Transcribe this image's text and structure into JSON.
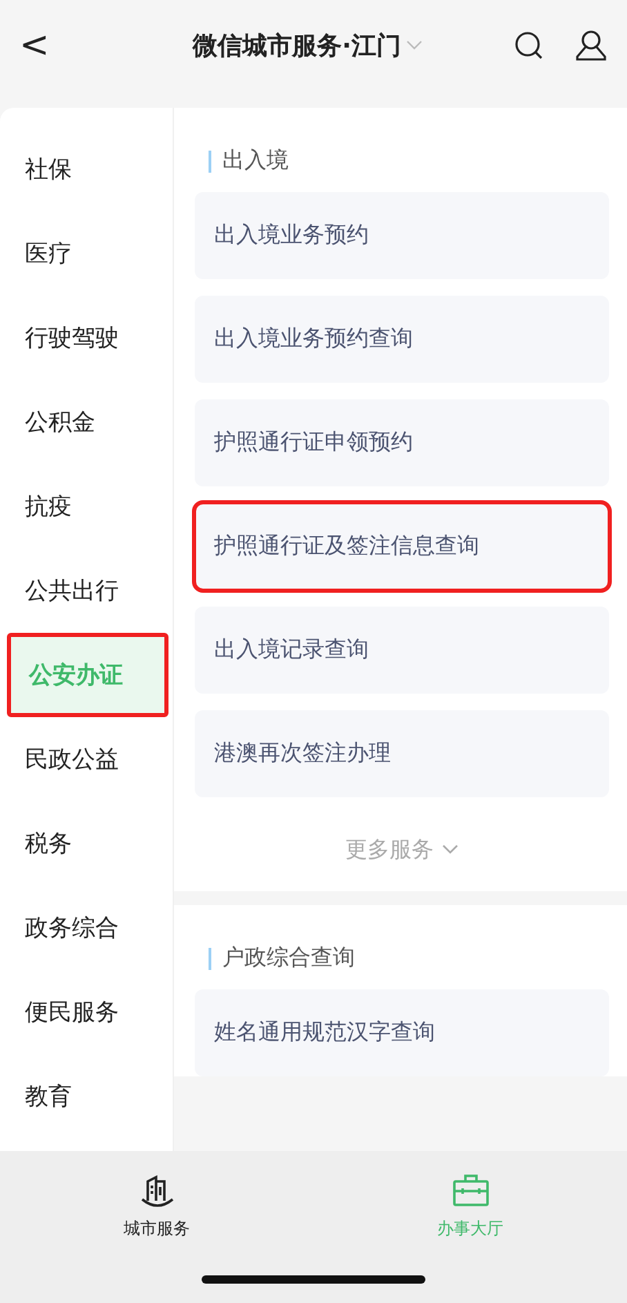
{
  "header": {
    "back": "<",
    "title": "微信城市服务·江门"
  },
  "sidebar": {
    "items": [
      {
        "label": "社保",
        "selected": false,
        "highlighted": false
      },
      {
        "label": "医疗",
        "selected": false,
        "highlighted": false
      },
      {
        "label": "行驶驾驶",
        "selected": false,
        "highlighted": false
      },
      {
        "label": "公积金",
        "selected": false,
        "highlighted": false
      },
      {
        "label": "抗疫",
        "selected": false,
        "highlighted": false
      },
      {
        "label": "公共出行",
        "selected": false,
        "highlighted": false
      },
      {
        "label": "公安办证",
        "selected": true,
        "highlighted": true
      },
      {
        "label": "民政公益",
        "selected": false,
        "highlighted": false
      },
      {
        "label": "税务",
        "selected": false,
        "highlighted": false
      },
      {
        "label": "政务综合",
        "selected": false,
        "highlighted": false
      },
      {
        "label": "便民服务",
        "selected": false,
        "highlighted": false
      },
      {
        "label": "教育",
        "selected": false,
        "highlighted": false
      }
    ]
  },
  "sections": [
    {
      "title": "出入境",
      "more": "更多服务",
      "services": [
        {
          "label": "出入境业务预约",
          "highlighted": false
        },
        {
          "label": "出入境业务预约查询",
          "highlighted": false
        },
        {
          "label": "护照通行证申领预约",
          "highlighted": false
        },
        {
          "label": "护照通行证及签注信息查询",
          "highlighted": true
        },
        {
          "label": "出入境记录查询",
          "highlighted": false
        },
        {
          "label": "港澳再次签注办理",
          "highlighted": false
        }
      ]
    },
    {
      "title": "户政综合查询",
      "services": [
        {
          "label": "姓名通用规范汉字查询",
          "highlighted": false
        }
      ]
    }
  ],
  "tab_bar": [
    {
      "label": "城市服务",
      "kind": "city",
      "selected": false
    },
    {
      "label": "办事大厅",
      "kind": "hall",
      "selected": true
    }
  ]
}
